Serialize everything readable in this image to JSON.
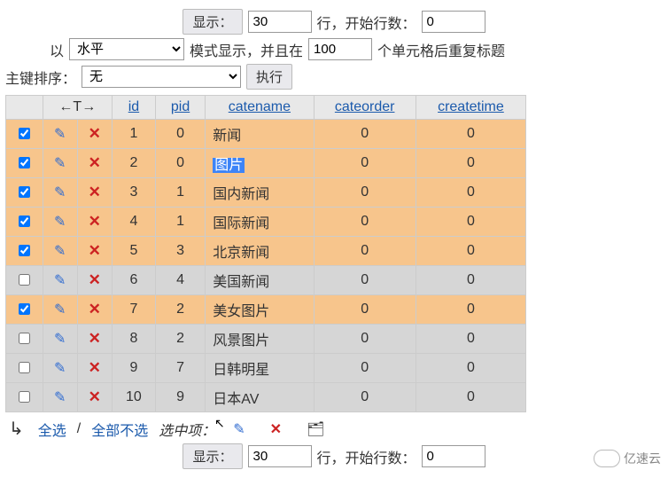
{
  "top": {
    "show_btn": "显示：",
    "rows_value": "30",
    "rows_label": "行，开始行数：",
    "start_value": "0"
  },
  "mode": {
    "prefix": "以",
    "mode_value": "水平",
    "mid1": "模式显示，并且在",
    "repeat_value": "100",
    "mid2": "个单元格后重复标题"
  },
  "sort": {
    "label": "主键排序：",
    "value": "无",
    "exec_btn": "执行"
  },
  "columns": {
    "nav": "←T→",
    "id": "id",
    "pid": "pid",
    "catename": "catename",
    "cateorder": "cateorder",
    "createtime": "createtime"
  },
  "rows": [
    {
      "chk": true,
      "cls": "orange",
      "id": "1",
      "pid": "0",
      "catename": "新闻",
      "cateorder": "0",
      "createtime": "0",
      "sel": false
    },
    {
      "chk": true,
      "cls": "orange",
      "id": "2",
      "pid": "0",
      "catename": "图片",
      "cateorder": "0",
      "createtime": "0",
      "sel": true
    },
    {
      "chk": true,
      "cls": "orange",
      "id": "3",
      "pid": "1",
      "catename": "国内新闻",
      "cateorder": "0",
      "createtime": "0",
      "sel": false
    },
    {
      "chk": true,
      "cls": "orange",
      "id": "4",
      "pid": "1",
      "catename": "国际新闻",
      "cateorder": "0",
      "createtime": "0",
      "sel": false
    },
    {
      "chk": true,
      "cls": "orange",
      "id": "5",
      "pid": "3",
      "catename": "北京新闻",
      "cateorder": "0",
      "createtime": "0",
      "sel": false
    },
    {
      "chk": false,
      "cls": "grey",
      "id": "6",
      "pid": "4",
      "catename": "美国新闻",
      "cateorder": "0",
      "createtime": "0",
      "sel": false
    },
    {
      "chk": true,
      "cls": "orange",
      "id": "7",
      "pid": "2",
      "catename": "美女图片",
      "cateorder": "0",
      "createtime": "0",
      "sel": false
    },
    {
      "chk": false,
      "cls": "grey",
      "id": "8",
      "pid": "2",
      "catename": "风景图片",
      "cateorder": "0",
      "createtime": "0",
      "sel": false
    },
    {
      "chk": false,
      "cls": "grey",
      "id": "9",
      "pid": "7",
      "catename": "日韩明星",
      "cateorder": "0",
      "createtime": "0",
      "sel": false
    },
    {
      "chk": false,
      "cls": "grey",
      "id": "10",
      "pid": "9",
      "catename": "日本AV",
      "cateorder": "0",
      "createtime": "0",
      "sel": false
    }
  ],
  "footer": {
    "select_all": "全选",
    "sep": " / ",
    "select_none": "全部不选",
    "selected_label": "选中项：",
    "show_btn": "显示：",
    "rows_value": "30",
    "rows_label": "行，开始行数：",
    "start_value": "0"
  },
  "logo": "亿速云"
}
